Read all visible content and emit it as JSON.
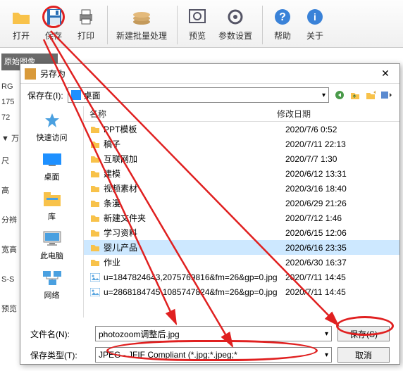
{
  "toolbar": {
    "open": "打开",
    "save": "保存",
    "print": "打印",
    "batch": "新建批量处理",
    "preview": "预览",
    "params": "参数设置",
    "help": "帮助",
    "about": "关于"
  },
  "left": {
    "orig": "原始图像",
    "rg": "RG",
    "sz1": "175",
    "sz2": "72",
    "ar1": "▼ 万",
    "s1": "尺",
    "s2": "高",
    "s3": "分辨",
    "s4": "宽高",
    "ss": "S-S",
    "pv": "预览"
  },
  "dialog": {
    "title": "另存为",
    "savein_lbl": "保存在(I):",
    "savein_val": "桌面",
    "col_name": "名称",
    "col_date": "修改日期",
    "places": {
      "quick": "快速访问",
      "desktop": "桌面",
      "libs": "库",
      "pc": "此电脑",
      "net": "网络"
    },
    "files": [
      {
        "name": "PPT模板",
        "date": "2020/7/6 0:52",
        "t": "f"
      },
      {
        "name": "稿子",
        "date": "2020/7/11 22:13",
        "t": "f"
      },
      {
        "name": "互联网加",
        "date": "2020/7/7 1:30",
        "t": "f"
      },
      {
        "name": "建模",
        "date": "2020/6/12 13:31",
        "t": "f"
      },
      {
        "name": "视频素材",
        "date": "2020/3/16 18:40",
        "t": "f"
      },
      {
        "name": "条漫",
        "date": "2020/6/29 21:26",
        "t": "f"
      },
      {
        "name": "新建文件夹",
        "date": "2020/7/12 1:46",
        "t": "f"
      },
      {
        "name": "学习资料",
        "date": "2020/6/15 12:06",
        "t": "f"
      },
      {
        "name": "婴儿产品",
        "date": "2020/6/16 23:35",
        "t": "f",
        "sel": true
      },
      {
        "name": "作业",
        "date": "2020/6/30 16:37",
        "t": "f"
      },
      {
        "name": "u=1847824643,2075769816&fm=26&gp=0.jpg",
        "date": "2020/7/11 14:45",
        "t": "i"
      },
      {
        "name": "u=2868184745 1085747824&fm=26&gp=0.jpg",
        "date": "2020/7/11 14:45",
        "t": "i"
      }
    ],
    "fn_lbl": "文件名(N):",
    "fn_val": "photozoom调整后.jpg",
    "ft_lbl": "保存类型(T):",
    "ft_val": "JPEG - JFIF Compliant (*.jpg;*.jpeg;*",
    "save_btn": "保存(S)",
    "cancel_btn": "取消"
  }
}
